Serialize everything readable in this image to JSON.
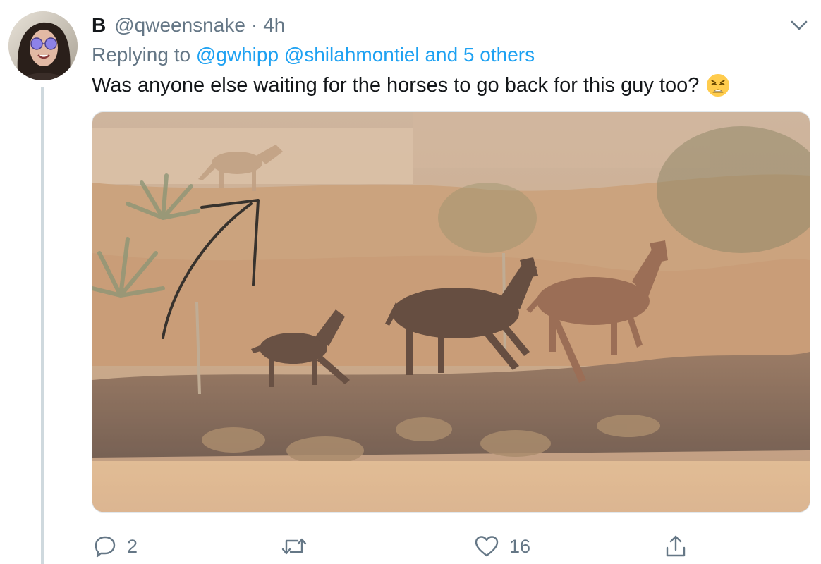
{
  "tweet": {
    "display_name": "B",
    "handle": "@qweensnake",
    "separator": "·",
    "time": "4h",
    "replying_prefix": "Replying to",
    "replying_users": [
      "@gwhipp",
      "@shilahmontiel"
    ],
    "replying_others": "and 5 others",
    "text": "Was anyone else waiting for the horses to go back for this guy too?",
    "emoji": "weary-face-emoji"
  },
  "actions": {
    "reply_count": "2",
    "retweet_count": "",
    "like_count": "16"
  },
  "colors": {
    "link": "#1da1f2",
    "secondary_text": "#657786",
    "primary_text": "#14171a",
    "thread_line": "#cfd9de"
  },
  "icons": {
    "caret": "chevron-down-icon",
    "reply": "speech-bubble-icon",
    "retweet": "retweet-icon",
    "like": "heart-icon",
    "share": "share-upload-icon"
  }
}
